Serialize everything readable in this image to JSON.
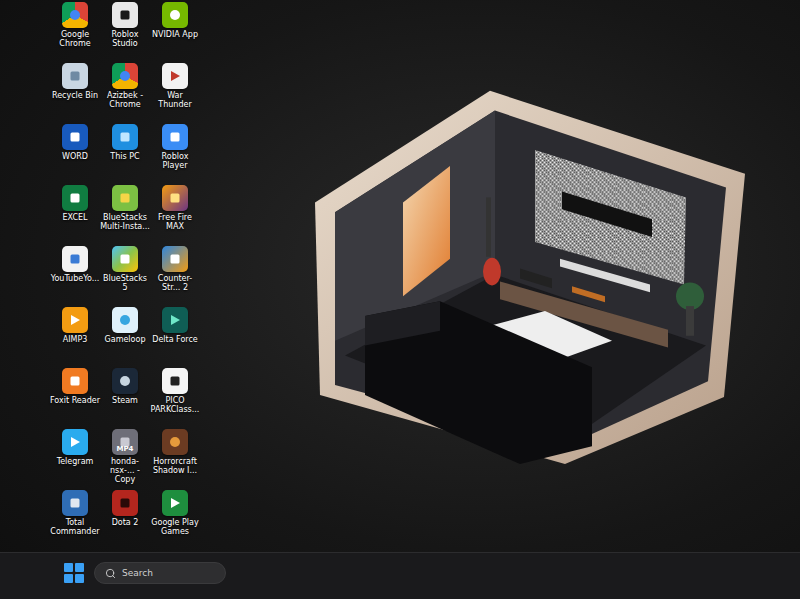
{
  "desktop": {
    "icons": [
      {
        "label": "Google Chrome"
      },
      {
        "label": "Recycle Bin"
      },
      {
        "label": "WORD"
      },
      {
        "label": "EXCEL"
      },
      {
        "label": "YouTubeYo..."
      },
      {
        "label": "AIMP3"
      },
      {
        "label": "Foxit Reader"
      },
      {
        "label": "Telegram"
      },
      {
        "label": "Total Commander"
      },
      {
        "label": "Roblox Studio"
      },
      {
        "label": "Azizbek - Chrome"
      },
      {
        "label": "This PC"
      },
      {
        "label": "BlueStacks Multi-Insta..."
      },
      {
        "label": "BlueStacks 5"
      },
      {
        "label": "Gameloop"
      },
      {
        "label": "Steam"
      },
      {
        "label": "honda-nsx-... - Copy",
        "badge": "MP4"
      },
      {
        "label": "Dota 2"
      },
      {
        "label": "NVIDIA App"
      },
      {
        "label": "War Thunder"
      },
      {
        "label": "Roblox Player"
      },
      {
        "label": "Free Fire MAX"
      },
      {
        "label": "Counter-Str... 2"
      },
      {
        "label": "Delta Force"
      },
      {
        "label": "PICO PARKClass..."
      },
      {
        "label": "Horrorcraft Shadow I..."
      },
      {
        "label": "Google Play Games"
      }
    ]
  },
  "taskbar": {
    "search": {
      "placeholder": "Search"
    }
  }
}
